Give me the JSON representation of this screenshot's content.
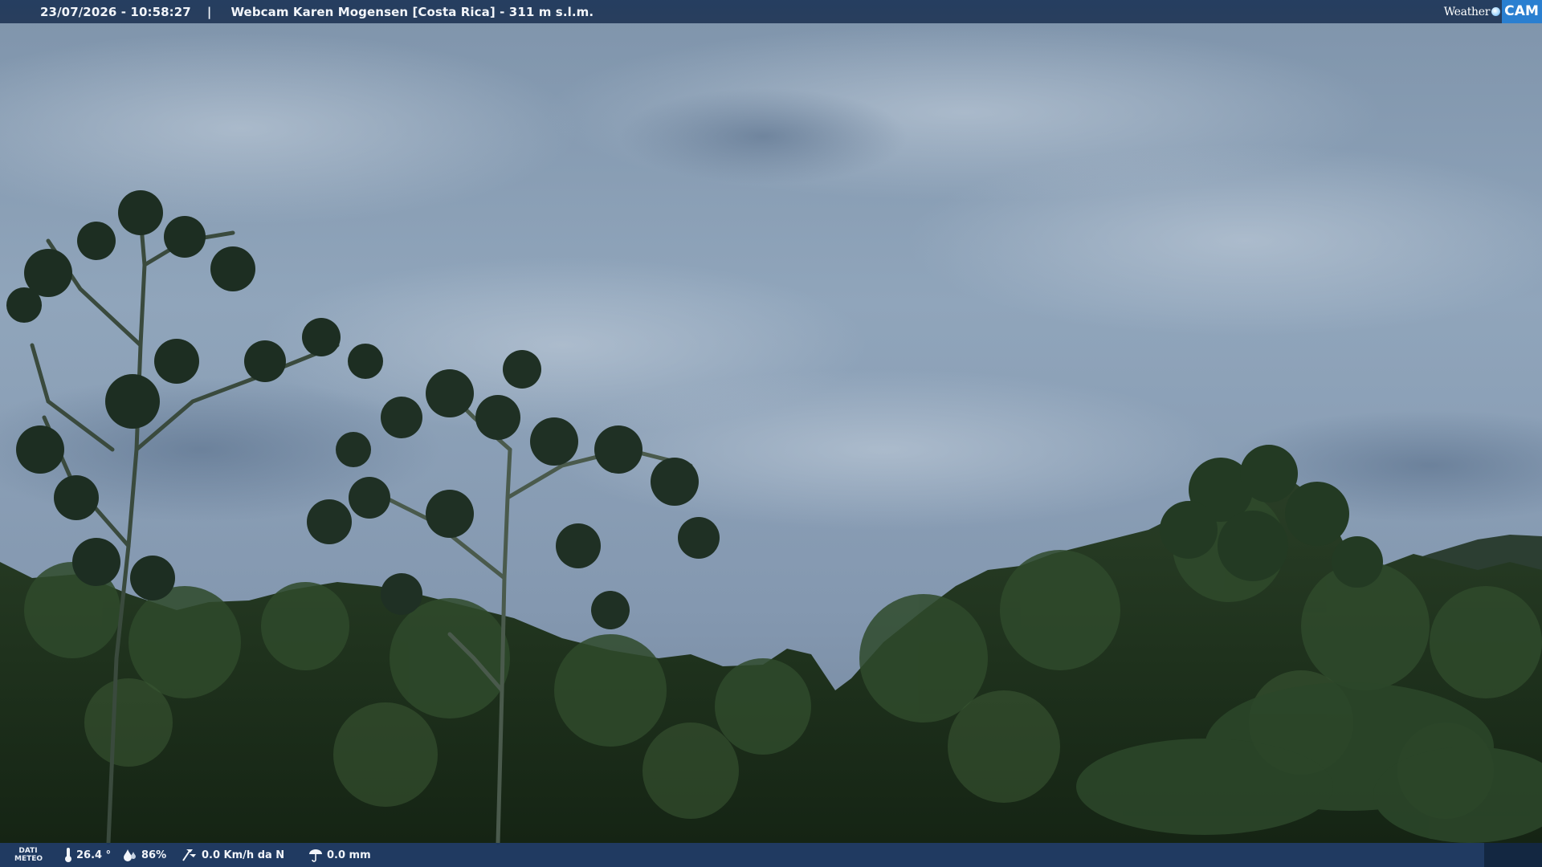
{
  "header": {
    "timestamp": "23/07/2026 - 10:58:27",
    "separator": "|",
    "title": "Webcam Karen Mogensen [Costa Rica]  - 311 m s.l.m.",
    "brand_left": "Weather",
    "brand_right": "CAM"
  },
  "footer": {
    "label_line1": "DATI",
    "label_line2": "METEO",
    "temperature": "26.4 °",
    "humidity": "86%",
    "wind": "0.0 Km/h da N",
    "rain": "0.0 mm"
  },
  "icons": {
    "temperature": "thermometer-icon",
    "humidity": "humidity-drop-icon",
    "wind": "wind-icon",
    "rain": "rain-icon"
  },
  "colors": {
    "bar_background": "#1c3252",
    "brand_accent": "#2a7fd0",
    "sky": "#8fa4ba",
    "foliage": "#1d2f1c"
  }
}
